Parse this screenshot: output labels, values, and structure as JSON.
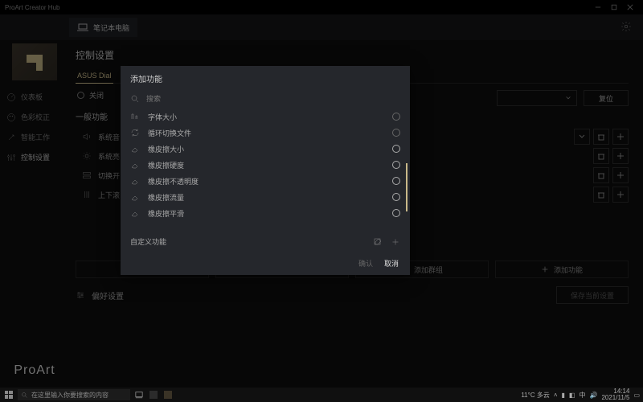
{
  "window": {
    "title": "ProArt Creator Hub"
  },
  "topbar": {
    "device_label": "笔记本电脑"
  },
  "sidebar": {
    "items": [
      {
        "label": "仪表板"
      },
      {
        "label": "色彩校正"
      },
      {
        "label": "智能工作"
      },
      {
        "label": "控制设置"
      }
    ],
    "brand": "ProArt"
  },
  "page": {
    "title": "控制设置",
    "tabs": [
      {
        "label": "ASUS Dial"
      }
    ],
    "toggle_off": "关闭",
    "subhead": "一般功能",
    "reset": "复位",
    "functions": [
      {
        "label": "系统音"
      },
      {
        "label": "系统亮"
      },
      {
        "label": "切换开"
      },
      {
        "label": "上下滚"
      }
    ],
    "bottom": {
      "add_group_1": "添加群组",
      "add_function": "添加功能",
      "add_group_2": "添加群组",
      "add_function_2": "添加功能"
    },
    "pref": "偏好设置",
    "save": "保存当前设置"
  },
  "modal": {
    "title": "添加功能",
    "search_placeholder": "搜索",
    "items": [
      {
        "label": "字体大小",
        "selectable": false
      },
      {
        "label": "循环切换文件",
        "selectable": false
      },
      {
        "label": "橡皮擦大小",
        "selectable": true
      },
      {
        "label": "橡皮擦硬度",
        "selectable": true
      },
      {
        "label": "橡皮擦不透明度",
        "selectable": true
      },
      {
        "label": "橡皮擦流量",
        "selectable": true
      },
      {
        "label": "橡皮擦平滑",
        "selectable": true
      }
    ],
    "custom": "自定义功能",
    "ok": "确认",
    "cancel": "取消"
  },
  "taskbar": {
    "search_placeholder": "在这里输入你要搜索的内容",
    "weather": "11°C 多云",
    "ime": "中",
    "time": "14:14",
    "date": "2021/11/5"
  }
}
